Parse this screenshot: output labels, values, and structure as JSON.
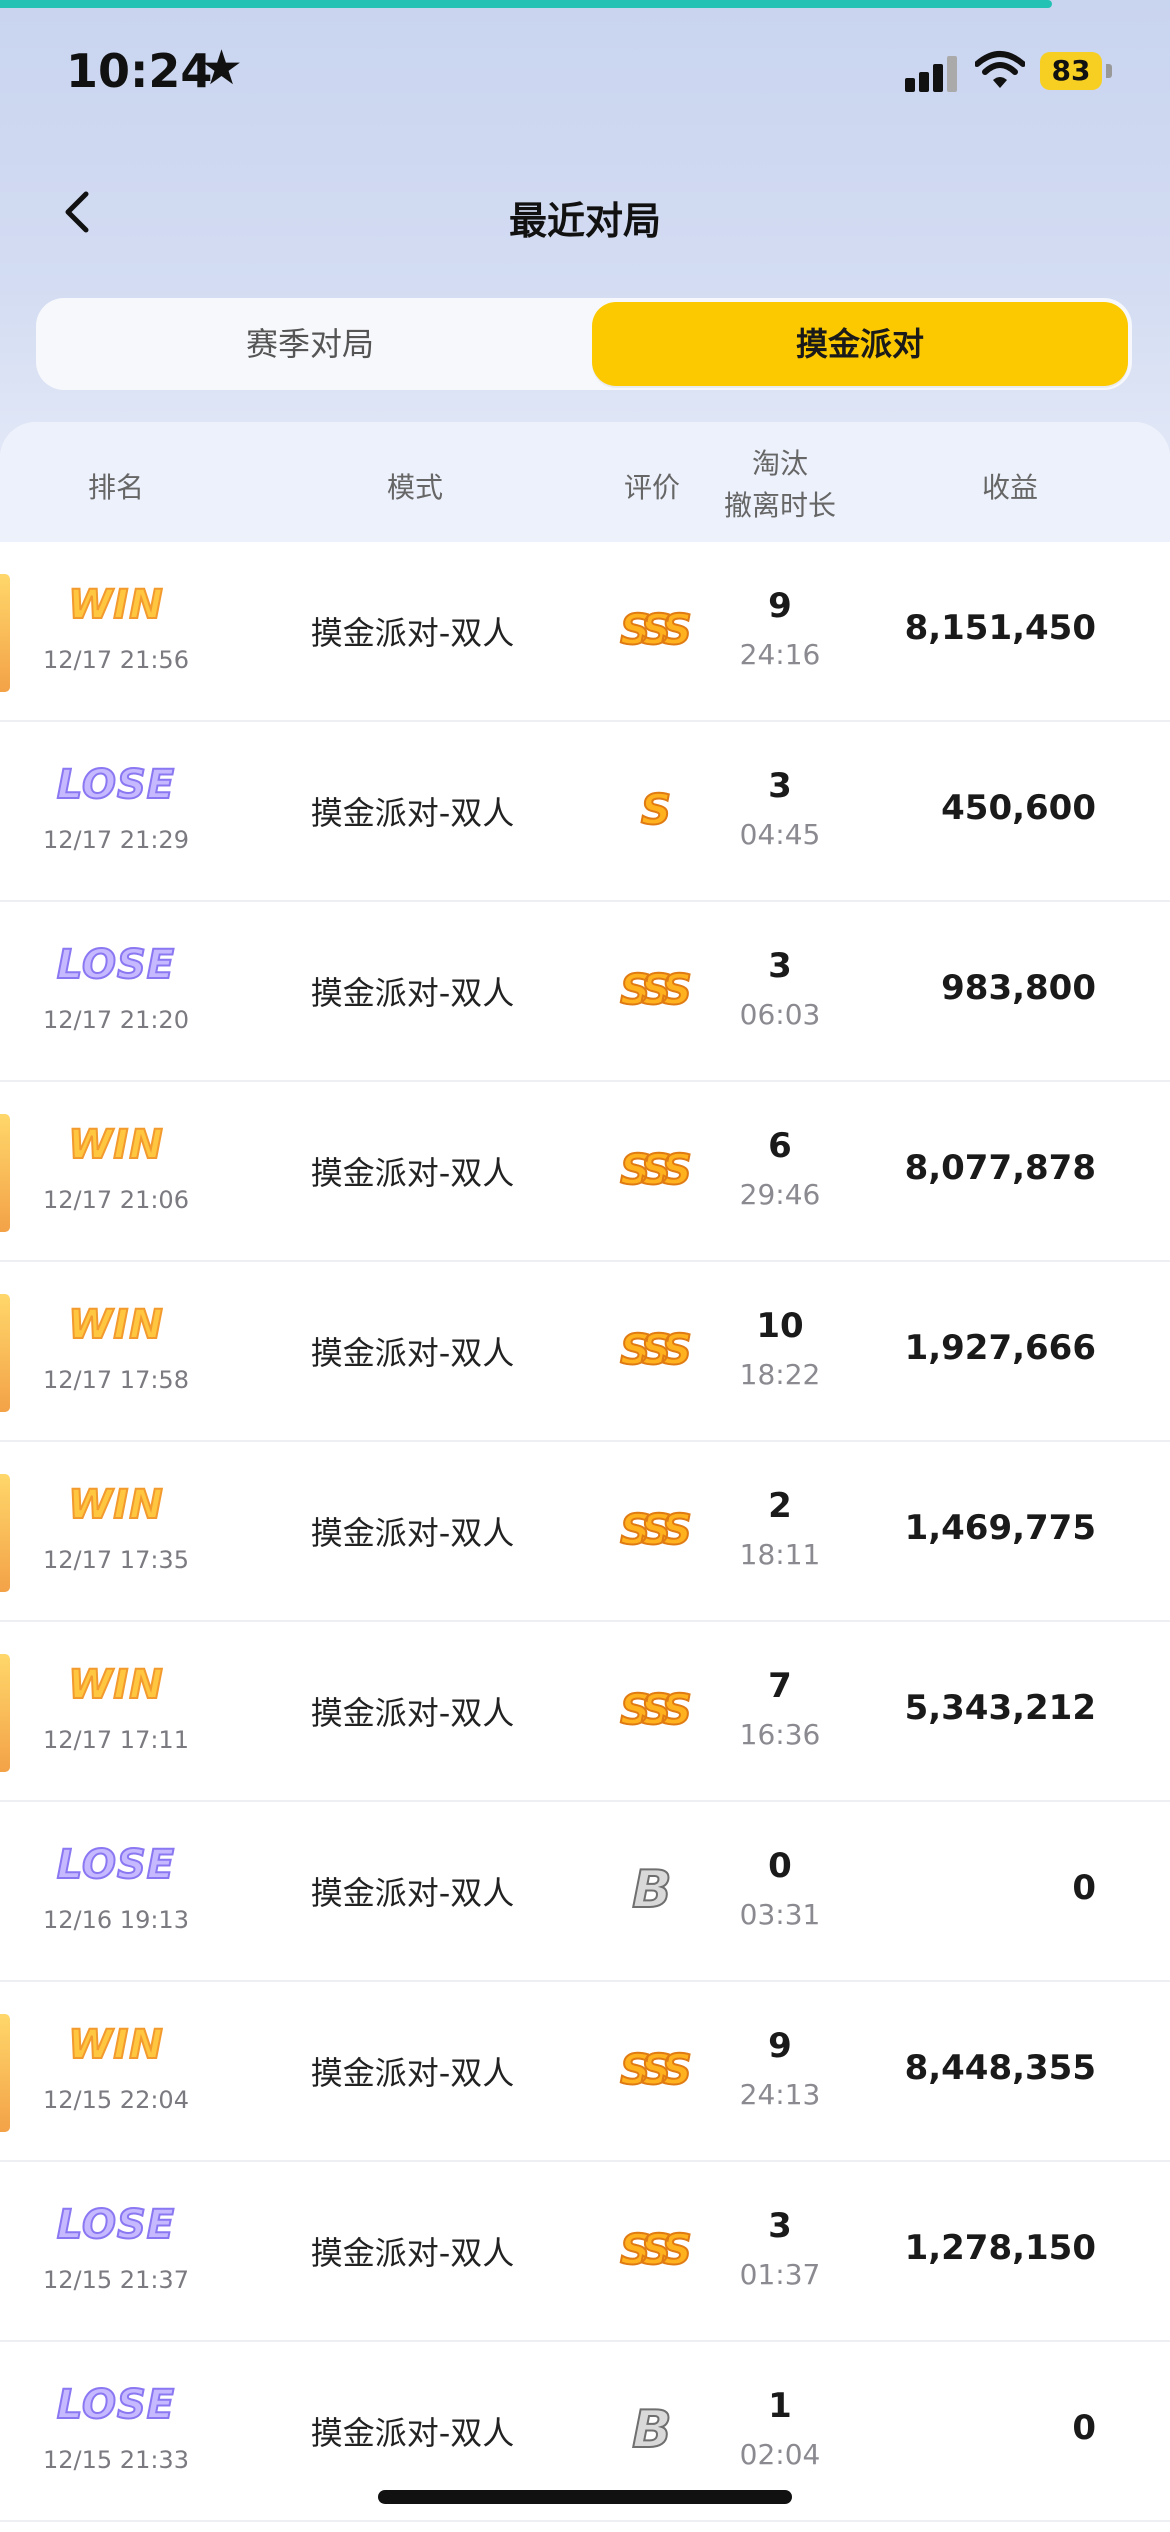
{
  "status_bar": {
    "time": "10:24",
    "battery": "83"
  },
  "header": {
    "title": "最近对局"
  },
  "tabs": [
    {
      "label": "赛季对局",
      "active": false
    },
    {
      "label": "摸金派对",
      "active": true
    }
  ],
  "columns": {
    "rank": "排名",
    "mode": "模式",
    "rating": "评价",
    "kills": "淘汰",
    "duration": "撤离时长",
    "profit": "收益"
  },
  "colors": {
    "accent": "#fcc900",
    "win": "#ffc640",
    "lose": "#8a77f2",
    "teal_progress": "#23c2b4"
  },
  "matches": [
    {
      "result": "WIN",
      "result_type": "win",
      "time": "12/17 21:56",
      "mode": "摸金派对-双人",
      "grade": "SSS",
      "grade_type": "gold",
      "kills": "9",
      "duration": "24:16",
      "profit": "8,151,450"
    },
    {
      "result": "LOSE",
      "result_type": "lose",
      "time": "12/17 21:29",
      "mode": "摸金派对-双人",
      "grade": "S",
      "grade_type": "gold",
      "kills": "3",
      "duration": "04:45",
      "profit": "450,600"
    },
    {
      "result": "LOSE",
      "result_type": "lose",
      "time": "12/17 21:20",
      "mode": "摸金派对-双人",
      "grade": "SSS",
      "grade_type": "gold",
      "kills": "3",
      "duration": "06:03",
      "profit": "983,800"
    },
    {
      "result": "WIN",
      "result_type": "win",
      "time": "12/17 21:06",
      "mode": "摸金派对-双人",
      "grade": "SSS",
      "grade_type": "gold",
      "kills": "6",
      "duration": "29:46",
      "profit": "8,077,878"
    },
    {
      "result": "WIN",
      "result_type": "win",
      "time": "12/17 17:58",
      "mode": "摸金派对-双人",
      "grade": "SSS",
      "grade_type": "gold",
      "kills": "10",
      "duration": "18:22",
      "profit": "1,927,666"
    },
    {
      "result": "WIN",
      "result_type": "win",
      "time": "12/17 17:35",
      "mode": "摸金派对-双人",
      "grade": "SSS",
      "grade_type": "gold",
      "kills": "2",
      "duration": "18:11",
      "profit": "1,469,775"
    },
    {
      "result": "WIN",
      "result_type": "win",
      "time": "12/17 17:11",
      "mode": "摸金派对-双人",
      "grade": "SSS",
      "grade_type": "gold",
      "kills": "7",
      "duration": "16:36",
      "profit": "5,343,212"
    },
    {
      "result": "LOSE",
      "result_type": "lose",
      "time": "12/16 19:13",
      "mode": "摸金派对-双人",
      "grade": "B",
      "grade_type": "gray",
      "kills": "0",
      "duration": "03:31",
      "profit": "0"
    },
    {
      "result": "WIN",
      "result_type": "win",
      "time": "12/15 22:04",
      "mode": "摸金派对-双人",
      "grade": "SSS",
      "grade_type": "gold",
      "kills": "9",
      "duration": "24:13",
      "profit": "8,448,355"
    },
    {
      "result": "LOSE",
      "result_type": "lose",
      "time": "12/15 21:37",
      "mode": "摸金派对-双人",
      "grade": "SSS",
      "grade_type": "gold",
      "kills": "3",
      "duration": "01:37",
      "profit": "1,278,150"
    },
    {
      "result": "LOSE",
      "result_type": "lose",
      "time": "12/15 21:33",
      "mode": "摸金派对-双人",
      "grade": "B",
      "grade_type": "gray",
      "kills": "1",
      "duration": "02:04",
      "profit": "0"
    }
  ]
}
